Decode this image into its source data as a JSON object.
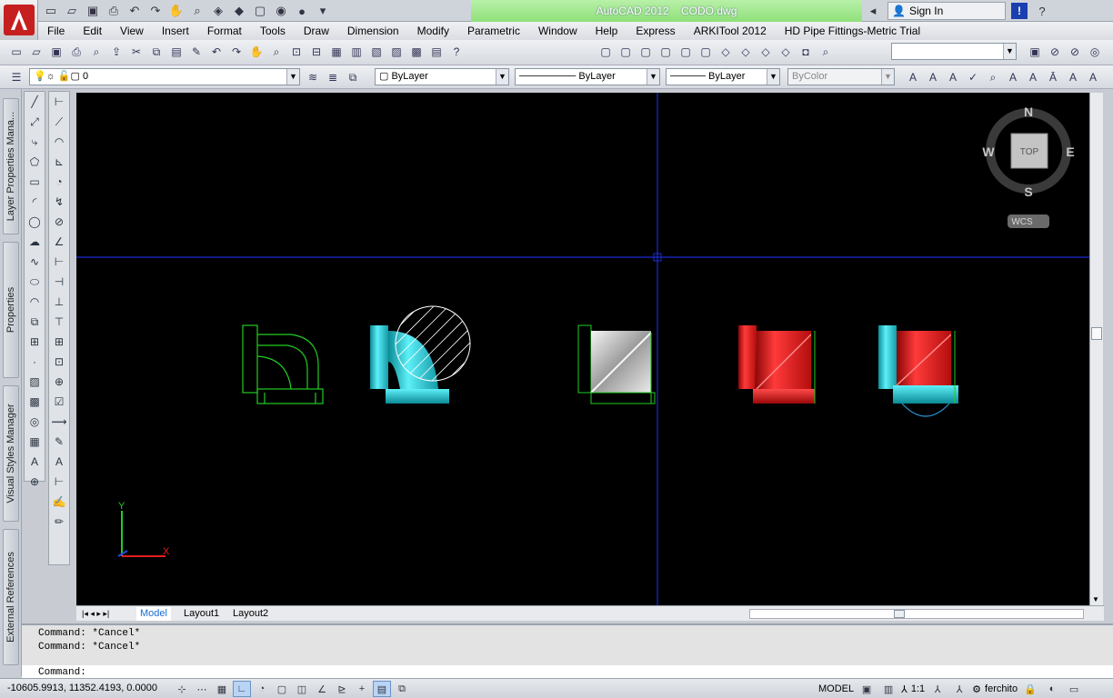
{
  "window": {
    "app_title": "AutoCAD 2012",
    "file_name": "CODO.dwg",
    "sign_in": "Sign In"
  },
  "menu": [
    "File",
    "Edit",
    "View",
    "Insert",
    "Format",
    "Tools",
    "Draw",
    "Dimension",
    "Modify",
    "Parametric",
    "Window",
    "Help",
    "Express",
    "ARKITool 2012",
    "HD Pipe Fittings-Metric Trial"
  ],
  "layer": {
    "current": "0",
    "color": "ByLayer",
    "linetype": "ByLayer",
    "lineweight": "ByLayer",
    "plotstyle": "ByColor"
  },
  "side_tabs": [
    "Layer Properties Mana...",
    "Properties",
    "Visual Styles Manager",
    "External References"
  ],
  "viewcube": {
    "n": "N",
    "s": "S",
    "e": "E",
    "w": "W",
    "face": "TOP",
    "ucs": "WCS"
  },
  "ucs_icon": {
    "y": "Y",
    "x": "X"
  },
  "layout_tabs": [
    "Model",
    "Layout1",
    "Layout2"
  ],
  "command": {
    "history": [
      "Command: *Cancel*",
      "Command: *Cancel*"
    ],
    "prompt": "Command:"
  },
  "status": {
    "coords": "-10605.9913, 11352.4193, 0.0000",
    "space": "MODEL",
    "scale": "1:1",
    "workspace": "ferchito"
  },
  "colors": {
    "canvas": "#000000",
    "crosshair": "#1a2ad8",
    "wire": "#22cc22",
    "cyan": "#20c8d8",
    "red": "#e01818",
    "steel": "#d8d8d8"
  }
}
